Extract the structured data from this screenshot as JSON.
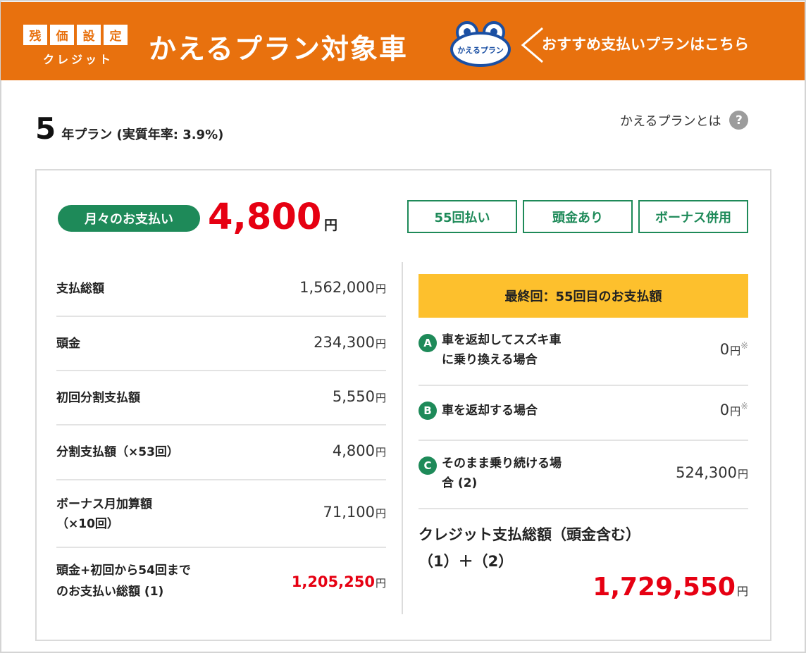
{
  "banner": {
    "badge_chars": [
      "残",
      "価",
      "設",
      "定"
    ],
    "badge_sub": "クレジット",
    "title": "かえるプラン対象車",
    "logo_text": "かえるプラン",
    "recommend": "おすすめ支払いプランはこちら",
    "color": "#e8710e"
  },
  "plan": {
    "years": "5",
    "text": "年プラン (実質年率: 3.9%)",
    "about_label": "かえるプランとは",
    "help_icon": "?"
  },
  "monthly": {
    "label": "月々のお支払い",
    "amount": "4,800",
    "unit": "円"
  },
  "options": [
    {
      "label": "55回払い"
    },
    {
      "label": "頭金あり"
    },
    {
      "label": "ボーナス併用"
    }
  ],
  "left_rows": [
    {
      "label": "支払総額",
      "value": "1,562,000",
      "unit": "円"
    },
    {
      "label": "頭金",
      "value": "234,300",
      "unit": "円"
    },
    {
      "label": "初回分割支払額",
      "value": "5,550",
      "unit": "円"
    },
    {
      "label": "分割支払額（×53回）",
      "value": "4,800",
      "unit": "円"
    },
    {
      "label_line1": "ボーナス月加算額",
      "label_line2": "（×10回）",
      "value": "71,100",
      "unit": "円"
    },
    {
      "label_line1": "頭金+初回から54回まで",
      "label_line2": "のお支払い総額 (1)",
      "value": "1,205,250",
      "unit": "円"
    }
  ],
  "final": {
    "title": "最終回：55回目のお支払額",
    "rows": [
      {
        "marker": "A",
        "label_line1": "車を返却してスズキ車",
        "label_line2": "に乗り換える場合",
        "value": "0",
        "unit": "円",
        "note": "※"
      },
      {
        "marker": "B",
        "label": "車を返却する場合",
        "value": "0",
        "unit": "円",
        "note": "※"
      },
      {
        "marker": "C",
        "label_line1": "そのまま乗り続ける場",
        "label_line2": "合 (2)",
        "value": "524,300",
        "unit": "円"
      }
    ]
  },
  "total": {
    "title_line1": "クレジット支払総額（頭金含む）",
    "title_line2": "（1）＋（2）",
    "amount": "1,729,550",
    "unit": "円"
  },
  "colors": {
    "accent_green": "#1e8a59",
    "highlight_red": "#e60012",
    "final_bar": "#fdc02d"
  }
}
